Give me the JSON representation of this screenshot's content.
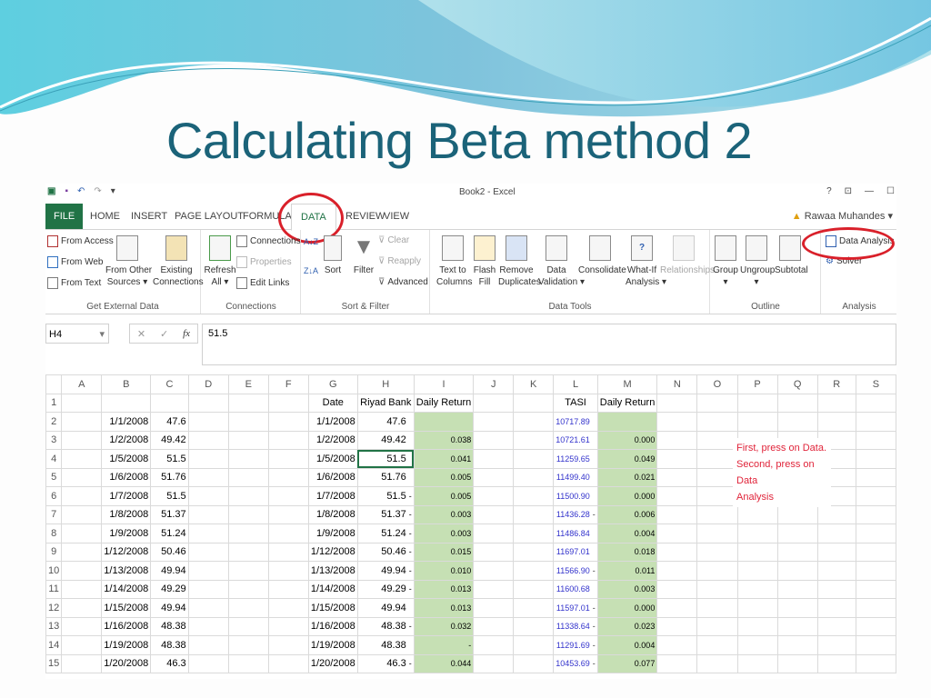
{
  "slide": {
    "title": "Calculating Beta method 2"
  },
  "excel": {
    "window_title": "Book2 - Excel",
    "quick_access": [
      "excel-logo",
      "save",
      "undo",
      "redo",
      "customize"
    ],
    "window_controls": [
      "?",
      "restore-ribbon",
      "minimize",
      "maximize"
    ],
    "user_name": "Rawaa Muhandes",
    "tabs": [
      "FILE",
      "HOME",
      "INSERT",
      "PAGE LAYOUT",
      "FORMULAS",
      "DATA",
      "REVIEW",
      "VIEW"
    ],
    "active_tab": "DATA",
    "ribbon": {
      "get_external_data": {
        "label": "Get External Data",
        "from_access": "From Access",
        "from_web": "From Web",
        "from_text": "From Text",
        "from_other_1": "From Other",
        "from_other_2": "Sources ▾",
        "existing_1": "Existing",
        "existing_2": "Connections"
      },
      "connections": {
        "label": "Connections",
        "refresh_1": "Refresh",
        "refresh_2": "All ▾",
        "connections": "Connections",
        "properties": "Properties",
        "edit_links": "Edit Links"
      },
      "sort_filter": {
        "label": "Sort & Filter",
        "sort": "Sort",
        "filter": "Filter",
        "clear": "Clear",
        "reapply": "Reapply",
        "advanced": "Advanced"
      },
      "data_tools": {
        "label": "Data Tools",
        "text_to_1": "Text to",
        "text_to_2": "Columns",
        "flash_1": "Flash",
        "flash_2": "Fill",
        "remove_1": "Remove",
        "remove_2": "Duplicates",
        "validation_1": "Data",
        "validation_2": "Validation ▾",
        "consolidate": "Consolidate",
        "whatif_1": "What-If",
        "whatif_2": "Analysis ▾",
        "relationships": "Relationships"
      },
      "outline": {
        "label": "Outline",
        "group": "Group",
        "ungroup": "Ungroup",
        "subtotal": "Subtotal",
        "arrow": "▾"
      },
      "analysis": {
        "label": "Analysis",
        "data_analysis": "Data Analysis",
        "solver": "Solver"
      }
    },
    "formula_bar": {
      "name_box": "H4",
      "cancel": "✕",
      "enter": "✓",
      "fx": "fx",
      "value": "51.5"
    },
    "columns": [
      "A",
      "B",
      "C",
      "D",
      "E",
      "F",
      "G",
      "H",
      "I",
      "J",
      "K",
      "L",
      "M",
      "N",
      "O",
      "P",
      "Q",
      "R",
      "S"
    ],
    "selected_column": "H",
    "selected_row": "4",
    "headers": {
      "date": "Date",
      "riyad_bank": "Riyad Bank",
      "daily_return_i": "Daily Return",
      "tasi": "TASI",
      "daily_return_m": "Daily Return"
    },
    "rows": [
      {
        "n": "2",
        "b": "1/1/2008",
        "c": "47.6",
        "g": "1/1/2008",
        "h": "47.6",
        "h_sign": "",
        "i": "",
        "l": "10717.89",
        "l_sign": "",
        "m": ""
      },
      {
        "n": "3",
        "b": "1/2/2008",
        "c": "49.42",
        "g": "1/2/2008",
        "h": "49.42",
        "h_sign": "",
        "i": "0.038",
        "l": "10721.61",
        "l_sign": "",
        "m": "0.000"
      },
      {
        "n": "4",
        "b": "1/5/2008",
        "c": "51.5",
        "g": "1/5/2008",
        "h": "51.5",
        "h_sign": "",
        "i": "0.041",
        "l": "11259.65",
        "l_sign": "",
        "m": "0.049"
      },
      {
        "n": "5",
        "b": "1/6/2008",
        "c": "51.76",
        "g": "1/6/2008",
        "h": "51.76",
        "h_sign": "",
        "i": "0.005",
        "l": "11499.40",
        "l_sign": "",
        "m": "0.021"
      },
      {
        "n": "6",
        "b": "1/7/2008",
        "c": "51.5",
        "g": "1/7/2008",
        "h": "51.5",
        "h_sign": "-",
        "i": "0.005",
        "l": "11500.90",
        "l_sign": "",
        "m": "0.000"
      },
      {
        "n": "7",
        "b": "1/8/2008",
        "c": "51.37",
        "g": "1/8/2008",
        "h": "51.37",
        "h_sign": "-",
        "i": "0.003",
        "l": "11436.28",
        "l_sign": "-",
        "m": "0.006"
      },
      {
        "n": "8",
        "b": "1/9/2008",
        "c": "51.24",
        "g": "1/9/2008",
        "h": "51.24",
        "h_sign": "-",
        "i": "0.003",
        "l": "11486.84",
        "l_sign": "",
        "m": "0.004"
      },
      {
        "n": "9",
        "b": "1/12/2008",
        "c": "50.46",
        "g": "1/12/2008",
        "h": "50.46",
        "h_sign": "-",
        "i": "0.015",
        "l": "11697.01",
        "l_sign": "",
        "m": "0.018"
      },
      {
        "n": "10",
        "b": "1/13/2008",
        "c": "49.94",
        "g": "1/13/2008",
        "h": "49.94",
        "h_sign": "-",
        "i": "0.010",
        "l": "11566.90",
        "l_sign": "-",
        "m": "0.011"
      },
      {
        "n": "11",
        "b": "1/14/2008",
        "c": "49.29",
        "g": "1/14/2008",
        "h": "49.29",
        "h_sign": "-",
        "i": "0.013",
        "l": "11600.68",
        "l_sign": "",
        "m": "0.003"
      },
      {
        "n": "12",
        "b": "1/15/2008",
        "c": "49.94",
        "g": "1/15/2008",
        "h": "49.94",
        "h_sign": "",
        "i": "0.013",
        "l": "11597.01",
        "l_sign": "-",
        "m": "0.000"
      },
      {
        "n": "13",
        "b": "1/16/2008",
        "c": "48.38",
        "g": "1/16/2008",
        "h": "48.38",
        "h_sign": "-",
        "i": "0.032",
        "l": "11338.64",
        "l_sign": "-",
        "m": "0.023"
      },
      {
        "n": "14",
        "b": "1/19/2008",
        "c": "48.38",
        "g": "1/19/2008",
        "h": "48.38",
        "h_sign": "",
        "i": "-",
        "l": "11291.69",
        "l_sign": "-",
        "m": "0.004"
      },
      {
        "n": "15",
        "b": "1/20/2008",
        "c": "46.3",
        "g": "1/20/2008",
        "h": "46.3",
        "h_sign": "-",
        "i": "0.044",
        "l": "10453.69",
        "l_sign": "-",
        "m": "0.077"
      }
    ],
    "note_lines": [
      "First, press on Data.",
      "Second, press on Data",
      "Analysis"
    ],
    "colors": {
      "excel_green": "#217346",
      "return_fill": "#c6e0b4",
      "tasi_blue": "#3333cc",
      "annotation_red": "#d9202a",
      "title_teal": "#1b6379"
    }
  }
}
